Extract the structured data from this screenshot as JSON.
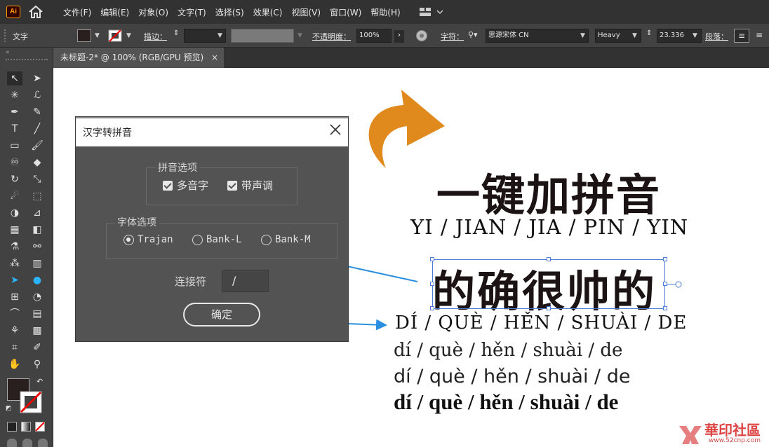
{
  "app": {
    "logo": "Ai"
  },
  "menu": [
    "文件(F)",
    "编辑(E)",
    "对象(O)",
    "文字(T)",
    "选择(S)",
    "效果(C)",
    "视图(V)",
    "窗口(W)",
    "帮助(H)"
  ],
  "control": {
    "tool_label": "文字",
    "stroke_label": "描边：",
    "opacity_label": "不透明度：",
    "opacity_value": "100%",
    "char_label": "字符：",
    "font_name": "思源宋体 CN",
    "font_weight": "Heavy",
    "font_size": "23.336",
    "para_label": "段落："
  },
  "tab": {
    "title": "未标题-2* @ 100% (RGB/GPU 预览)",
    "close": "×"
  },
  "dialog": {
    "title": "汉字转拼音",
    "pinyin_group": "拼音选项",
    "opt_multi": "多音字",
    "opt_tone": "带声调",
    "font_group": "字体选项",
    "font_options": [
      "Trajan",
      "Bank-L",
      "Bank-M"
    ],
    "joiner_label": "连接符",
    "joiner_value": "/",
    "ok": "确定"
  },
  "artboard": {
    "headline": "一键加拼音",
    "pinyin_caps": "YI / JIAN / JIA / PIN / YIN",
    "selected_text": "的确很帅的",
    "pinyin_tone_caps": "DÍ / QUÈ / HĚN / SHUÀI / DE",
    "pinyin_serif": "dí / què / hěn / shuài / de",
    "pinyin_sans": "dí / què / hěn / shuài / de",
    "pinyin_bold": "dí / què / hěn / shuài / de"
  },
  "watermark": {
    "text": "華印社區",
    "url": "www.52cnp.com"
  },
  "colors": {
    "accent_orange": "#e08a1e",
    "arrow_blue": "#2b8fe0",
    "selection": "#4d7bd6"
  }
}
